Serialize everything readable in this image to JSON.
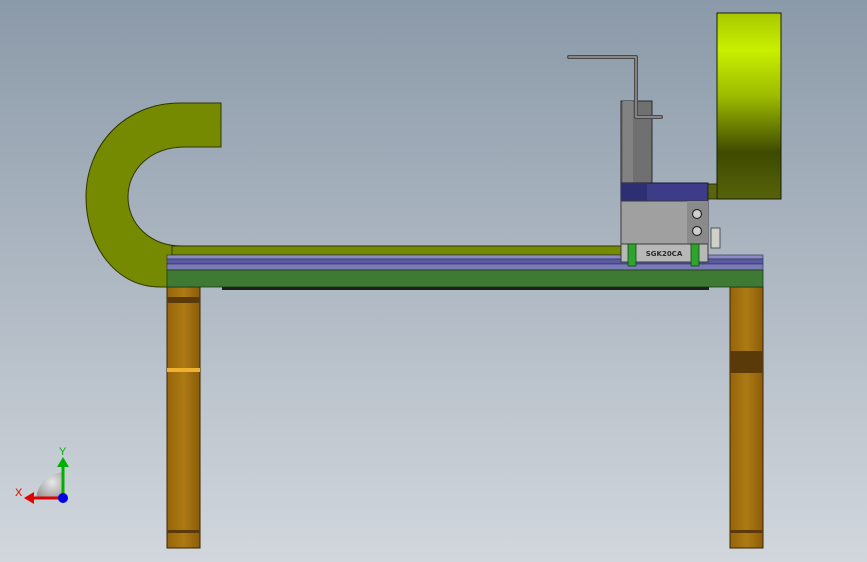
{
  "colors": {
    "bg_top": "#8b9aa9",
    "bg_bottom": "#d2d7dd",
    "chain": "#758a00",
    "rail_blue": "#5a5a9e",
    "rail_green": "#3f7a34",
    "leg": "#a7720f",
    "leg_dark": "#5a3a08",
    "motor_top": "#c8f000",
    "motor_bottom": "#3f4a00",
    "carriage_blue": "#3c3c88",
    "carriage_grey": "#a0a0a0",
    "post_grey": "#707070",
    "axis_x": "#e00000",
    "axis_y": "#00b000",
    "axis_z": "#0000e0"
  },
  "carriage": {
    "label": "SGK20CA"
  },
  "triad": {
    "x_label": "X",
    "y_label": "Y"
  }
}
